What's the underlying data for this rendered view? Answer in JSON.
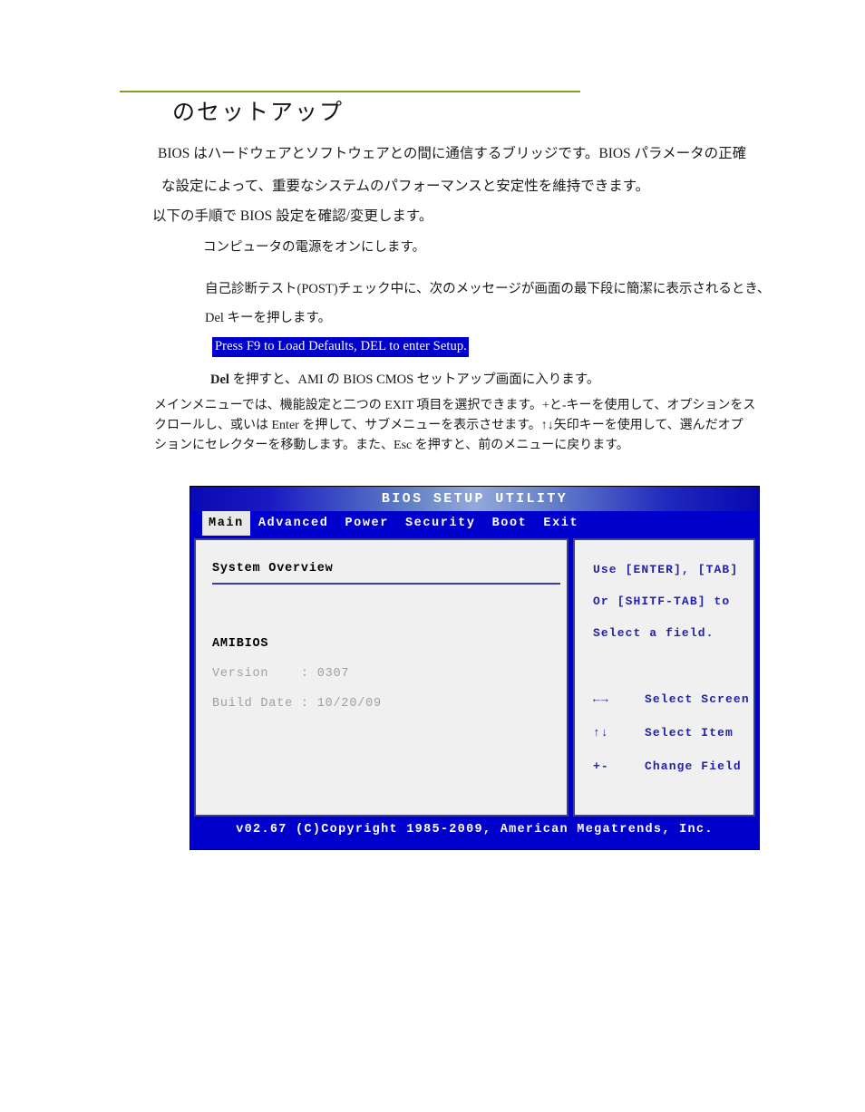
{
  "document": {
    "title": "のセットアップ",
    "rule_color": "#7aa02a",
    "intro": {
      "line1": "BIOS はハードウェアとソフトウェアとの間に通信するブリッジです。BIOS パラメータの正確",
      "line2": "な設定によって、重要なシステムのパフォーマンスと安定性を維持できます。",
      "line3": "以下の手順で BIOS 設定を確認/変更します。"
    },
    "steps": {
      "step1": "コンピュータの電源をオンにします。",
      "step2_line1": "自己診断テスト(POST)チェック中に、次のメッセージが画面の最下段に簡潔に表示されるとき、",
      "step2_line2": "Del キーを押します。",
      "post_message": "Press F9 to Load Defaults, DEL to enter Setup.",
      "post_message_bg": "#0000cd",
      "step3_bold": "Del",
      "step3_rest": " を押すと、AMI の BIOS CMOS セットアップ画面に入ります。"
    },
    "navigation_note": {
      "line1": "メインメニューでは、機能設定と二つの EXIT 項目を選択できます。+と-キーを使用して、オプションをス",
      "line2": "クロールし、或いは Enter を押して、サブメニューを表示させます。↑↓矢印キーを使用して、選んだオプ",
      "line3": "ションにセレクターを移動します。また、Esc を押すと、前のメニューに戻ります。"
    }
  },
  "bios": {
    "title": "BIOS SETUP UTILITY",
    "title_bar_color": "#0000cc",
    "tabs": [
      {
        "label": "Main",
        "active": true
      },
      {
        "label": "Advanced",
        "active": false
      },
      {
        "label": "Power",
        "active": false
      },
      {
        "label": "Security",
        "active": false
      },
      {
        "label": "Boot",
        "active": false
      },
      {
        "label": "Exit",
        "active": false
      }
    ],
    "main_panel": {
      "section_title": "System Overview",
      "group_label": "AMIBIOS",
      "fields": [
        {
          "label": "Version    : ",
          "value": "0307"
        },
        {
          "label": "Build Date : ",
          "value": "10/20/09"
        }
      ]
    },
    "help_panel": {
      "lines": [
        "Use [ENTER], [TAB]",
        "Or [SHITF-TAB] to",
        "Select a field."
      ],
      "keys": [
        {
          "glyph": "←→",
          "desc": "Select Screen"
        },
        {
          "glyph": "↑↓",
          "desc": "Select Item"
        },
        {
          "glyph": "+-",
          "desc": "Change Field"
        }
      ],
      "text_color": "#2222aa"
    },
    "footer": "v02.67 (C)Copyright 1985-2009, American Megatrends, Inc."
  }
}
